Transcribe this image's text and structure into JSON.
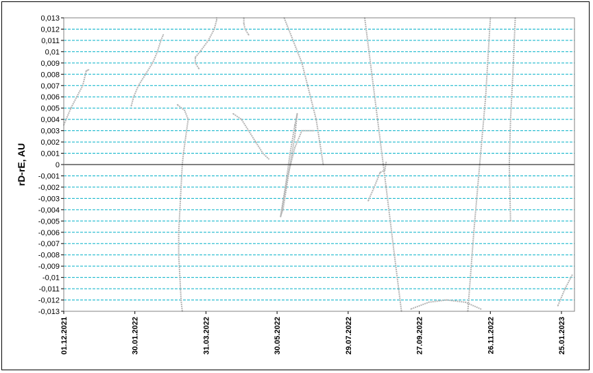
{
  "chart_data": {
    "type": "scatter",
    "title": "",
    "xlabel": "",
    "ylabel": "rD-rE, AU",
    "ylim": [
      -0.013,
      0.013
    ],
    "ystep": 0.001,
    "grid": true,
    "xlim": [
      "2021-12-01",
      "2023-02-05"
    ],
    "x_ticks": [
      "01.12.2021",
      "30.01.2022",
      "31.03.2022",
      "30.05.2022",
      "29.07.2022",
      "27.09.2022",
      "26.11.2022",
      "25.01.2023"
    ],
    "y_ticks": [
      "0,013",
      "0,012",
      "0,011",
      "0,01",
      "0,009",
      "0,008",
      "0,007",
      "0,006",
      "0,005",
      "0,004",
      "0,003",
      "0,002",
      "0,001",
      "0",
      "-0,001",
      "-0,002",
      "-0,003",
      "-0,004",
      "-0,005",
      "-0,006",
      "-0,007",
      "-0,008",
      "-0,009",
      "-0,01",
      "-0,011",
      "-0,012",
      "-0,013"
    ],
    "colors": {
      "grid": "#00b0c8",
      "series": "#b4b4b4",
      "zero_line": "#000000",
      "points": "#000000"
    },
    "series": [
      {
        "values": [
          [
            "2021-12-01",
            0.0035
          ],
          [
            "2021-12-07",
            0.005
          ],
          [
            "2021-12-12",
            0.006
          ],
          [
            "2021-12-17",
            0.007
          ],
          [
            "2021-12-20",
            0.0083
          ],
          [
            "2021-12-22",
            0.0084
          ]
        ]
      },
      {
        "values": [
          [
            "2022-01-27",
            0.0052
          ],
          [
            "2022-01-29",
            0.006
          ],
          [
            "2022-02-02",
            0.007
          ],
          [
            "2022-02-08",
            0.008
          ],
          [
            "2022-02-14",
            0.009
          ],
          [
            "2022-02-18",
            0.01
          ],
          [
            "2022-02-21",
            0.011
          ],
          [
            "2022-02-23",
            0.0115
          ]
        ]
      },
      {
        "values": [
          [
            "2022-03-25",
            0.0085
          ],
          [
            "2022-03-22",
            0.009
          ],
          [
            "2022-03-22",
            0.0095
          ],
          [
            "2022-03-26",
            0.01
          ],
          [
            "2022-04-02",
            0.011
          ],
          [
            "2022-04-07",
            0.012
          ],
          [
            "2022-04-09",
            0.0128
          ],
          [
            "2022-04-09",
            0.013
          ]
        ]
      },
      {
        "values": [
          [
            "2022-05-06",
            0.0115
          ],
          [
            "2022-05-03",
            0.012
          ],
          [
            "2022-05-02",
            0.0125
          ],
          [
            "2022-05-02",
            0.013
          ]
        ]
      },
      {
        "values": [
          [
            "2022-03-07",
            0.0053
          ],
          [
            "2022-03-13",
            0.0048
          ],
          [
            "2022-03-16",
            0.004
          ],
          [
            "2022-03-14",
            0.0025
          ],
          [
            "2022-03-12",
            0.001
          ],
          [
            "2022-03-11",
            0.0
          ],
          [
            "2022-03-10",
            -0.002
          ],
          [
            "2022-03-09",
            -0.004
          ],
          [
            "2022-03-08",
            -0.006
          ],
          [
            "2022-03-08",
            -0.008
          ],
          [
            "2022-03-09",
            -0.01
          ],
          [
            "2022-03-10",
            -0.012
          ],
          [
            "2022-03-11",
            -0.013
          ]
        ]
      },
      {
        "values": [
          [
            "2022-04-23",
            0.0045
          ],
          [
            "2022-04-30",
            0.004
          ],
          [
            "2022-05-06",
            0.003
          ],
          [
            "2022-05-12",
            0.002
          ],
          [
            "2022-05-18",
            0.001
          ],
          [
            "2022-05-23",
            0.0005
          ]
        ]
      },
      {
        "values": [
          [
            "2022-06-02",
            -0.0046
          ],
          [
            "2022-06-06",
            -0.002
          ],
          [
            "2022-06-10",
            0.001
          ],
          [
            "2022-06-14",
            0.0035
          ],
          [
            "2022-06-16",
            0.0045
          ],
          [
            "2022-06-14",
            0.0025
          ],
          [
            "2022-06-10",
            0.0
          ],
          [
            "2022-06-07",
            -0.002
          ],
          [
            "2022-06-04",
            -0.004
          ],
          [
            "2022-06-02",
            -0.0046
          ],
          [
            "2022-06-08",
            -0.001
          ],
          [
            "2022-06-14",
            0.0015
          ],
          [
            "2022-06-20",
            0.003
          ],
          [
            "2022-06-30",
            0.003
          ]
        ]
      },
      {
        "values": [
          [
            "2022-08-15",
            -0.0032
          ],
          [
            "2022-08-20",
            -0.002
          ],
          [
            "2022-08-25",
            -0.0007
          ],
          [
            "2022-08-29",
            -0.0005
          ],
          [
            "2022-08-30",
            0.0002
          ]
        ]
      },
      {
        "values": [
          [
            "2022-09-20",
            -0.0128
          ],
          [
            "2022-10-05",
            -0.0122
          ],
          [
            "2022-10-20",
            -0.012
          ],
          [
            "2022-11-05",
            -0.0122
          ],
          [
            "2022-11-18",
            -0.0128
          ]
        ]
      },
      {
        "values": [
          [
            "2022-11-07",
            -0.013
          ],
          [
            "2022-11-12",
            -0.006
          ],
          [
            "2022-11-17",
            0.0
          ],
          [
            "2022-11-22",
            0.006
          ],
          [
            "2022-11-26",
            0.013
          ]
        ]
      },
      {
        "values": [
          [
            "2022-06-05",
            0.013
          ],
          [
            "2022-06-20",
            0.009
          ],
          [
            "2022-07-02",
            0.004
          ],
          [
            "2022-07-08",
            0.0
          ]
        ]
      },
      {
        "values": [
          [
            "2022-08-12",
            0.013
          ],
          [
            "2022-08-18",
            0.008
          ],
          [
            "2022-08-24",
            0.003
          ],
          [
            "2022-08-30",
            -0.002
          ],
          [
            "2022-09-06",
            -0.008
          ],
          [
            "2022-09-12",
            -0.013
          ]
        ]
      },
      {
        "values": [
          [
            "2022-12-17",
            0.013
          ],
          [
            "2022-12-15",
            0.008
          ],
          [
            "2022-12-13",
            0.004
          ],
          [
            "2022-12-12",
            0.0
          ],
          [
            "2022-12-13",
            -0.005
          ]
        ]
      },
      {
        "values": [
          [
            "2023-01-22",
            -0.0125
          ],
          [
            "2023-01-28",
            -0.011
          ],
          [
            "2023-02-03",
            -0.0098
          ]
        ]
      }
    ]
  }
}
